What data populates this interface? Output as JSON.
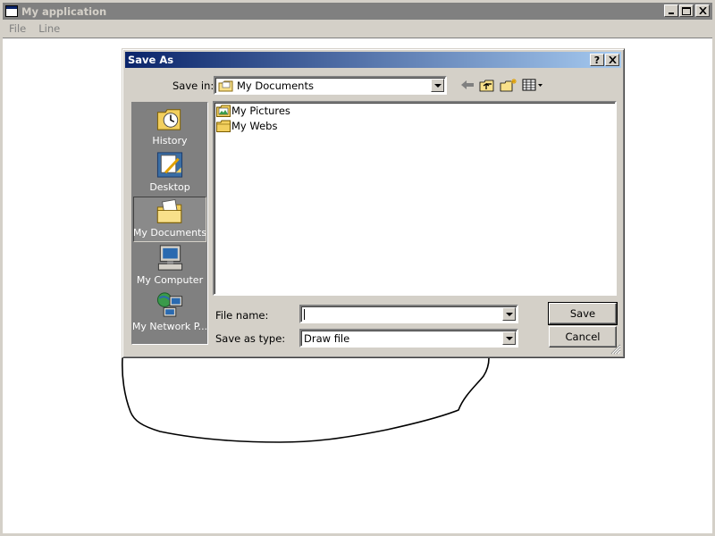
{
  "app": {
    "title": "My application",
    "menu": [
      "File",
      "Line"
    ]
  },
  "dialog": {
    "title": "Save As",
    "help_glyph": "?",
    "close_glyph": "✕",
    "save_in_label": "Save in:",
    "save_in_value": "My Documents",
    "places": [
      "History",
      "Desktop",
      "My Documents",
      "My Computer",
      "My Network P..."
    ],
    "selected_place": "My Documents",
    "files": [
      "My Pictures",
      "My Webs"
    ],
    "file_name_label": "File name:",
    "file_name_value": "",
    "save_as_type_label": "Save as type:",
    "save_as_type_value": "Draw file",
    "save_button": "Save",
    "cancel_button": "Cancel"
  },
  "icons": {
    "window_controls": [
      "minimize-icon",
      "maximize-icon",
      "close-icon"
    ],
    "toolbar": [
      "back-arrow-icon",
      "up-folder-icon",
      "new-folder-icon",
      "view-menu-icon"
    ]
  },
  "colors": {
    "title_active_start": "#0a246a",
    "title_active_end": "#a6caf0",
    "title_inactive": "#808080",
    "face": "#d4d0c8",
    "places_bar": "#808080"
  }
}
